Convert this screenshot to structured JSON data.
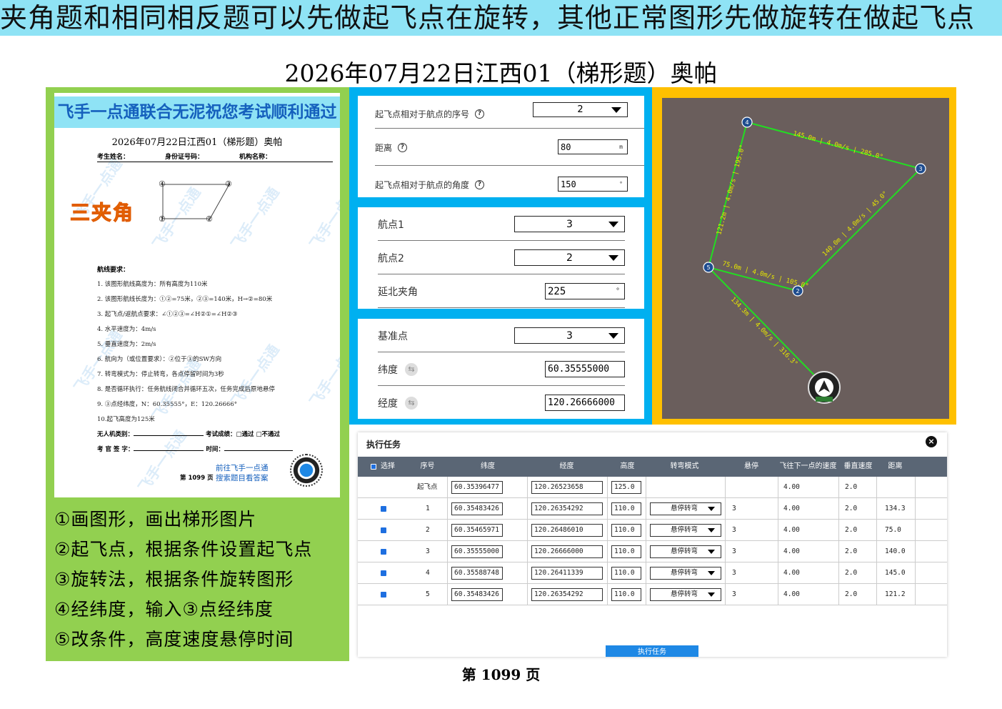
{
  "banner": "夹角题和相同相反题可以先做起飞点在旋转，其他正常图形先做旋转在做起飞点",
  "main_title": "2026年07月22日江西01（梯形题）奥帕",
  "paper": {
    "banner": "飞手一点通联合无泥祝您考试顺利通过",
    "title": "2026年07月22日江西01（梯形题）奥帕",
    "fields": [
      "考生姓名：",
      "身份证号码：",
      "机构名称："
    ],
    "sketch_labels": [
      "④",
      "③",
      "①",
      "②"
    ],
    "stamp": "三夹角",
    "req_head": "航线要求：",
    "requirements": [
      "1. 该图形航线高度为：所有高度为110米",
      "2. 该图形航线长度为：①②=75米，②③=140米，H→②=80米",
      "3. 起飞点/返航点要求：∠①②③=∠H②①=∠H②③",
      "4. 水平速度为：4m/s",
      "5. 垂直速度为：2m/s",
      "6. 航向为（或位置要求）：②位于③的SW方向",
      "7. 转弯模式为：停止转弯，各点停留时间为3秒",
      "8. 是否循环执行：任务航线闭合并循环五次，任务完成后原地悬停",
      "9. ③点经纬度，N：60.35555°，E：120.26666°",
      "10.起飞高度为125米"
    ],
    "sign1a": "无人机类别：",
    "sign1b": "考试成绩：□通过 □不通过",
    "sign2a": "考 官 签 字：",
    "sign2b": "时间：",
    "page": "第 1099 页",
    "link1": "前往飞手一点通",
    "link2": "搜索题目看答案",
    "watermark": "飞手一点通"
  },
  "steps": [
    "①画图形，画出梯形图片",
    "②起飞点，根据条件设置起飞点",
    "③旋转法，根据条件旋转图形",
    "④经纬度，输入③点经纬度",
    "⑤改条件，高度速度悬停时间"
  ],
  "takeoff_card": {
    "seq_label": "起飞点相对于航点的序号",
    "seq_value": "2",
    "dist_label": "距离",
    "dist_value": "80",
    "dist_unit": "m",
    "angle_label": "起飞点相对于航点的角度",
    "angle_value": "150",
    "angle_unit": "°"
  },
  "angle_card": {
    "wp1_label": "航点1",
    "wp1_value": "3",
    "wp2_label": "航点2",
    "wp2_value": "2",
    "north_label": "延北夹角",
    "north_value": "225",
    "north_unit": "°"
  },
  "ref_card": {
    "ref_label": "基准点",
    "ref_value": "3",
    "lat_label": "纬度",
    "lat_value": "60.35555000",
    "lon_label": "经度",
    "lon_value": "120.26666000"
  },
  "map": {
    "point_labels": [
      "4",
      "3",
      "5",
      "2"
    ],
    "segments": [
      "145.0m | 4.0m/s | 285.0°",
      "121.2m | 4.0m/s | 195.0°",
      "140.0m | 4.0m/s | 45.0°",
      "75.0m | 4.0m/s | 105.0°",
      "134.3m | 4.0m/s | 316.3°"
    ],
    "line_color": "#22dd22",
    "label_color": "#e6e600"
  },
  "task": {
    "title": "执行任务",
    "close": "×",
    "headers": [
      "选择",
      "序号",
      "纬度",
      "经度",
      "高度",
      "转弯模式",
      "悬停",
      "飞往下一点的速度",
      "垂直速度",
      "距离"
    ],
    "takeoff_row": {
      "seq": "起飞点",
      "lat": "60.35396477",
      "lon": "120.26523658",
      "alt": "125.0",
      "speed": "4.00",
      "vspeed": "2.0"
    },
    "rows": [
      {
        "seq": "1",
        "lat": "60.35483426",
        "lon": "120.26354292",
        "alt": "110.0",
        "mode": "悬停转弯",
        "hover": "3",
        "speed": "4.00",
        "vspeed": "2.0",
        "dist": "134.3"
      },
      {
        "seq": "2",
        "lat": "60.35465971",
        "lon": "120.26486010",
        "alt": "110.0",
        "mode": "悬停转弯",
        "hover": "3",
        "speed": "4.00",
        "vspeed": "2.0",
        "dist": "75.0"
      },
      {
        "seq": "3",
        "lat": "60.35555000",
        "lon": "120.26666000",
        "alt": "110.0",
        "mode": "悬停转弯",
        "hover": "3",
        "speed": "4.00",
        "vspeed": "2.0",
        "dist": "140.0"
      },
      {
        "seq": "4",
        "lat": "60.35588748",
        "lon": "120.26411339",
        "alt": "110.0",
        "mode": "悬停转弯",
        "hover": "3",
        "speed": "4.00",
        "vspeed": "2.0",
        "dist": "145.0"
      },
      {
        "seq": "5",
        "lat": "60.35483426",
        "lon": "120.26354292",
        "alt": "110.0",
        "mode": "悬停转弯",
        "hover": "3",
        "speed": "4.00",
        "vspeed": "2.0",
        "dist": "121.2"
      }
    ],
    "exec_button": "执行任务"
  },
  "page_number": "第 1099 页"
}
